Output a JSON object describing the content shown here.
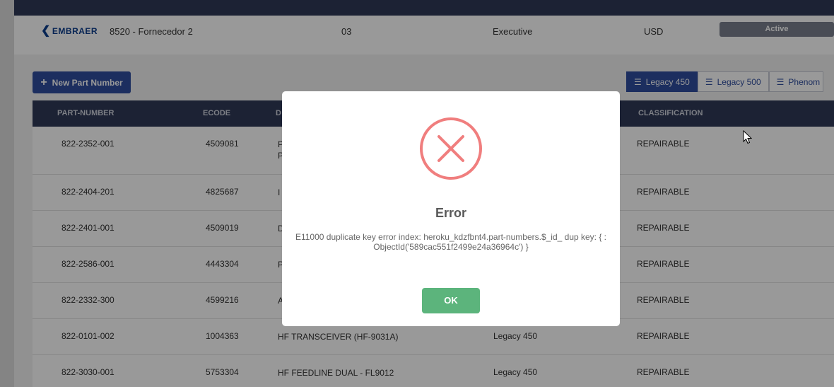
{
  "supplier": {
    "brand": "EMBRAER",
    "name": "8520 - Fornecedor 2",
    "order": "03",
    "channel": "Executive",
    "currency": "USD",
    "status": "Active"
  },
  "toolbar": {
    "new_button": "New Part Number",
    "tabs": [
      "Legacy 450",
      "Legacy 500",
      "Phenom"
    ]
  },
  "table": {
    "headers": [
      "PART-NUMBER",
      "ECODE",
      "D",
      "CLASSIFICATION"
    ],
    "rows": [
      {
        "part": "822-2352-001",
        "ecode": "4509081",
        "desc": "P\nP",
        "model": "",
        "class": "REPAIRABLE"
      },
      {
        "part": "822-2404-201",
        "ecode": "4825687",
        "desc": "I",
        "model": "",
        "class": "REPAIRABLE"
      },
      {
        "part": "822-2401-001",
        "ecode": "4509019",
        "desc": "D",
        "model": "",
        "class": "REPAIRABLE"
      },
      {
        "part": "822-2586-001",
        "ecode": "4443304",
        "desc": "P",
        "model": "",
        "class": "REPAIRABLE"
      },
      {
        "part": "822-2332-300",
        "ecode": "4599216",
        "desc": "A",
        "model": "",
        "class": "REPAIRABLE"
      },
      {
        "part": "822-0101-002",
        "ecode": "1004363",
        "desc": "HF TRANSCEIVER (HF-9031A)",
        "model": "Legacy 450",
        "class": "REPAIRABLE"
      },
      {
        "part": "822-3030-001",
        "ecode": "5753304",
        "desc": "HF FEEDLINE DUAL - FL9012",
        "model": "Legacy 450",
        "class": "REPAIRABLE"
      }
    ]
  },
  "modal": {
    "title": "Error",
    "message": "E11000 duplicate key error index: heroku_kdzfbnt4.part-numbers.$_id_ dup key: { : ObjectId('589cac551f2499e24a36964c') }",
    "ok_label": "OK"
  },
  "colors": {
    "header_bg": "#2f3a57",
    "primary": "#2f4d9e",
    "error_red": "#f07e7e",
    "ok_green": "#5cb47c"
  }
}
